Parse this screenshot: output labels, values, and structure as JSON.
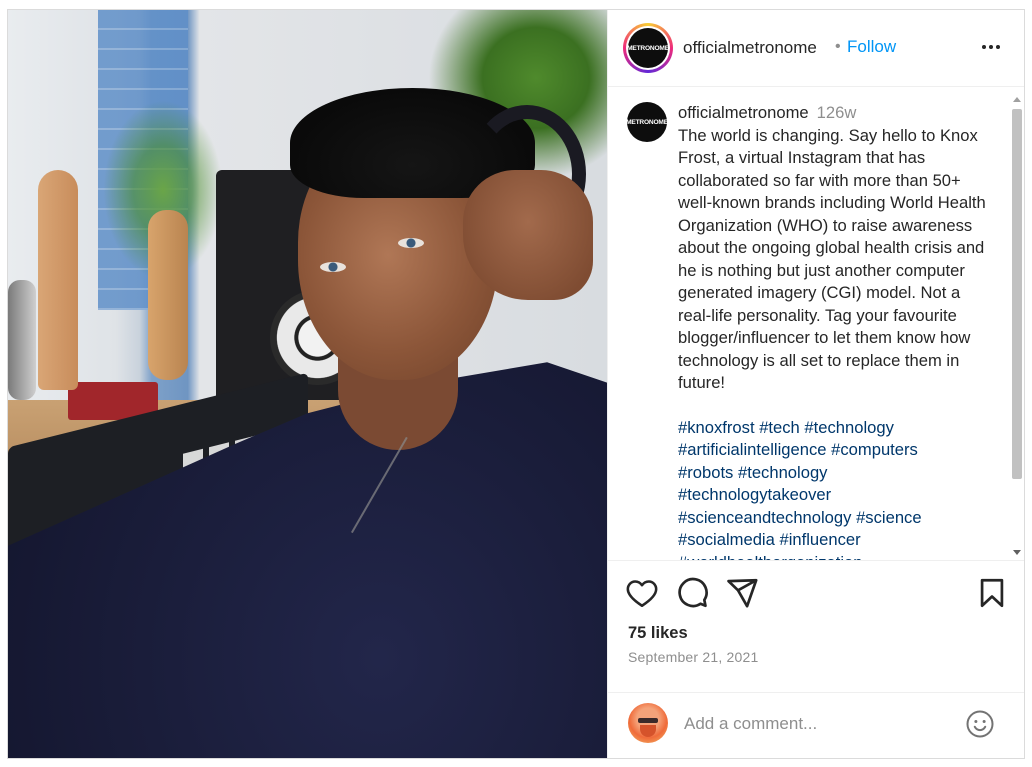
{
  "post": {
    "image_alt": "Knox Frost virtual influencer wearing headphones in a music studio"
  },
  "header": {
    "logo_text": "METRONOME",
    "username": "officialmetronome",
    "separator": "•",
    "follow_label": "Follow",
    "more_icon": "more-horizontal-icon"
  },
  "caption": {
    "logo_text": "METRONOME",
    "username": "officialmetronome",
    "time_ago": "126w",
    "text": "The world is changing. Say hello to Knox Frost, a virtual Instagram that has collaborated so far with more than 50+ well-known brands including World Health Organization (WHO) to raise awareness about the ongoing global health crisis and he is nothing but just another computer generated imagery (CGI) model. Not a real-life personality. Tag your favourite blogger/influencer to let them know how technology is all set to replace them in future!",
    "hashtags": [
      "#knoxfrost",
      "#tech",
      "#technology",
      "#artificialintelligence",
      "#computers",
      "#robots",
      "#technology",
      "#technologytakeover",
      "#scienceandtechnology",
      "#science",
      "#socialmedia",
      "#influencer",
      "#worldhealthorganization"
    ]
  },
  "actions": {
    "like_icon": "heart-icon",
    "comment_icon": "comment-bubble-icon",
    "share_icon": "paper-plane-icon",
    "save_icon": "bookmark-icon"
  },
  "stats": {
    "likes": "75 likes",
    "date": "September 21, 2021"
  },
  "comment_box": {
    "placeholder": "Add a comment...",
    "emoji_icon": "smiley-icon"
  },
  "colors": {
    "accent": "#0095f6",
    "hashtag": "#00376b",
    "muted": "#8e8e8e",
    "text": "#262626"
  }
}
